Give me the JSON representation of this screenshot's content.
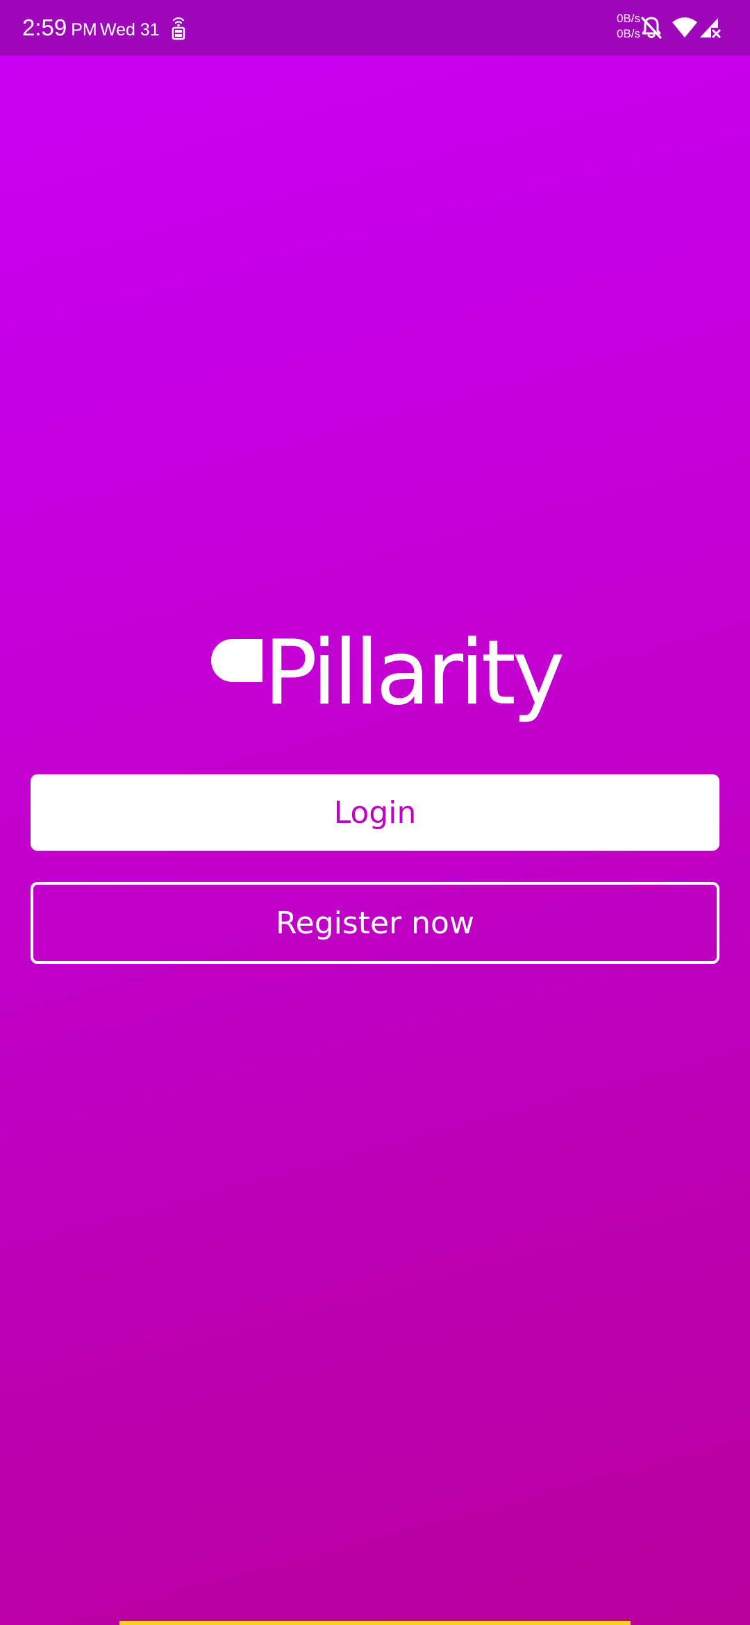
{
  "status_bar": {
    "time": "2:59",
    "ampm": "PM",
    "date": "Wed 31",
    "net_speed_up": "0B/s",
    "net_speed_down": "0B/s",
    "icons": [
      "nfc-icon",
      "bell-off-icon",
      "wifi-icon",
      "signal-icon"
    ]
  },
  "app": {
    "logo_text": "Pillarity",
    "logo_icon": "pill-icon"
  },
  "actions": {
    "login_label": "Login",
    "register_label": "Register now"
  },
  "colors": {
    "background_top": "#c800f6",
    "background_bottom": "#b8009c",
    "status_bar": "#9d06b9",
    "login_text": "#c000c6",
    "indicator": "#f4d020"
  }
}
